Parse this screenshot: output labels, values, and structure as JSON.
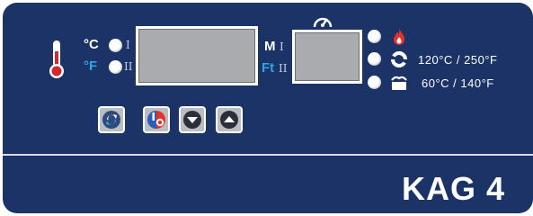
{
  "units": {
    "celsius": "°C",
    "fahrenheit": "°F"
  },
  "roman": {
    "one": "I",
    "two": "II"
  },
  "display_labels": {
    "m": "M",
    "ft": "Ft"
  },
  "temperature_presets": [
    {
      "label": "120°C / 250°F",
      "icon": "fan-icon"
    },
    {
      "label": "60°C / 140°F",
      "icon": "holding-cabinet-icon"
    }
  ],
  "indicators": [
    "flame-icon",
    "fan-icon",
    "holding-cabinet-icon"
  ],
  "buttons": [
    "cycle-button",
    "on-off-button",
    "down-arrow-button",
    "up-arrow-button"
  ],
  "model": "KAG 4",
  "colors": {
    "panel": "#1b3366",
    "accent_blue": "#2fa4e6",
    "flame": "#e8312a",
    "display": "#a9abae"
  }
}
